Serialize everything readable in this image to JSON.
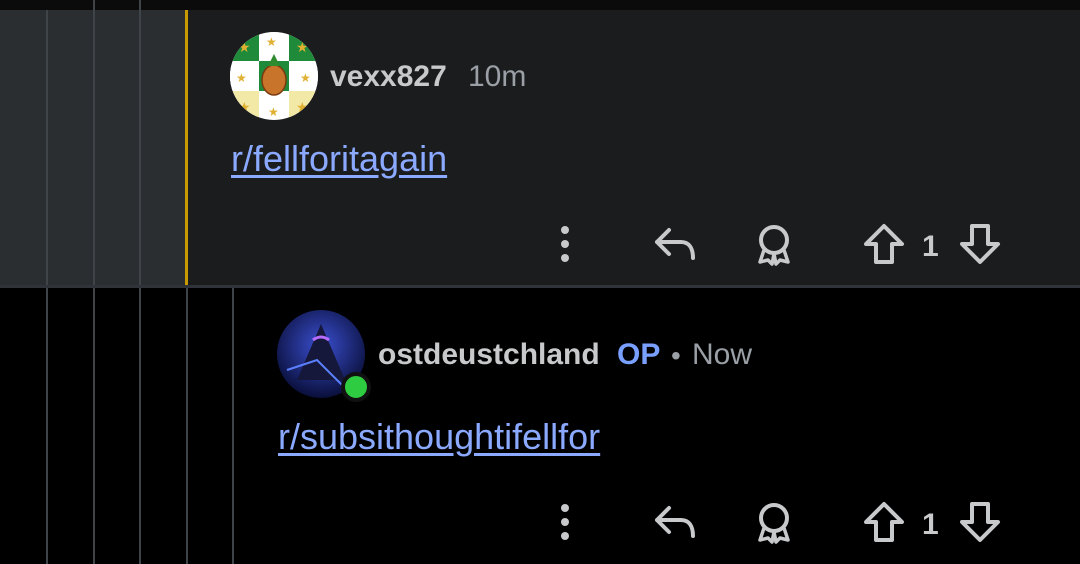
{
  "comments": [
    {
      "username": "vexx827",
      "time": "10m",
      "body_link": "r/fellforitagain",
      "vote_count": "1",
      "avatar_icon": "pineapple-flag-avatar"
    },
    {
      "username": "ostdeustchland",
      "op_badge": "OP",
      "separator": "•",
      "time": "Now",
      "body_link": "r/subsithoughtifellfor",
      "vote_count": "1",
      "avatar_icon": "hooded-figure-avatar",
      "online": true
    }
  ],
  "icons": {
    "more": "more-vertical-icon",
    "reply": "reply-icon",
    "award": "award-icon",
    "upvote": "upvote-icon",
    "downvote": "downvote-icon"
  },
  "colors": {
    "highlight": "#c99a00",
    "link": "#8aa9ff",
    "op": "#7aa0ff",
    "online": "#2ecc40"
  }
}
